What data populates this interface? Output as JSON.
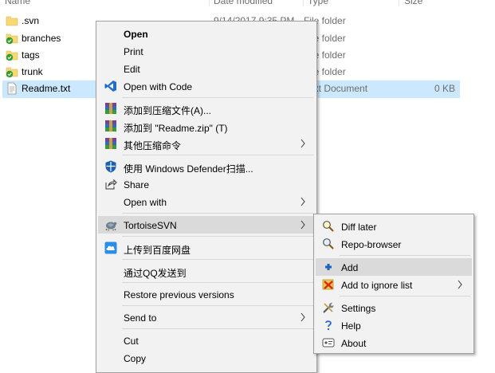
{
  "explorer": {
    "columns": {
      "name": "Name",
      "date": "Date modified",
      "type": "Type",
      "size": "Size"
    },
    "files": [
      {
        "name": ".svn",
        "date": "9/14/2017 9:35 PM",
        "type": "File folder",
        "size": ""
      },
      {
        "name": "branches",
        "date": "",
        "type": "File folder",
        "size": ""
      },
      {
        "name": "tags",
        "date": "",
        "type": "File folder",
        "size": ""
      },
      {
        "name": "trunk",
        "date": "",
        "type": "File folder",
        "size": ""
      },
      {
        "name": "Readme.txt",
        "date": "",
        "type": "Text Document",
        "size": "0 KB"
      }
    ]
  },
  "context_menu": {
    "items": [
      {
        "label": "Open",
        "icon": "none",
        "bold": true
      },
      {
        "label": "Print",
        "icon": "none"
      },
      {
        "label": "Edit",
        "icon": "none"
      },
      {
        "label": "Open with Code",
        "icon": "vscode-icon"
      },
      {
        "label": "添加到压缩文件(A)...",
        "icon": "winrar-icon"
      },
      {
        "label": "添加到 \"Readme.zip\" (T)",
        "icon": "winrar-icon"
      },
      {
        "label": "其他压缩命令",
        "icon": "winrar-icon",
        "submenu": true
      },
      {
        "label": "使用 Windows Defender扫描...",
        "icon": "defender-icon"
      },
      {
        "label": "Share",
        "icon": "share-icon"
      },
      {
        "label": "Open with",
        "icon": "none",
        "submenu": true
      },
      {
        "label": "TortoiseSVN",
        "icon": "tortoise-icon",
        "submenu": true,
        "highlighted": true
      },
      {
        "label": "上传到百度网盘",
        "icon": "baidu-cloud-icon"
      },
      {
        "label": "通过QQ发送到",
        "icon": "none"
      },
      {
        "label": "Restore previous versions",
        "icon": "none"
      },
      {
        "label": "Send to",
        "icon": "none",
        "submenu": true
      },
      {
        "label": "Cut",
        "icon": "none"
      },
      {
        "label": "Copy",
        "icon": "none"
      }
    ]
  },
  "tortoise_submenu": {
    "items": [
      {
        "label": "Diff later",
        "icon": "diff-icon"
      },
      {
        "label": "Repo-browser",
        "icon": "repo-browser-icon"
      },
      {
        "label": "Add",
        "icon": "add-icon",
        "highlighted": true
      },
      {
        "label": "Add to ignore list",
        "icon": "ignore-icon",
        "submenu": true
      },
      {
        "label": "Settings",
        "icon": "settings-icon"
      },
      {
        "label": "Help",
        "icon": "help-icon"
      },
      {
        "label": "About",
        "icon": "about-icon"
      }
    ]
  },
  "colors": {
    "selection": "#cce8ff",
    "menu_bg": "#f2f2f2",
    "menu_highlight": "#dadada",
    "folder": "#f8d775",
    "svn_ok": "#2f9e2f"
  }
}
